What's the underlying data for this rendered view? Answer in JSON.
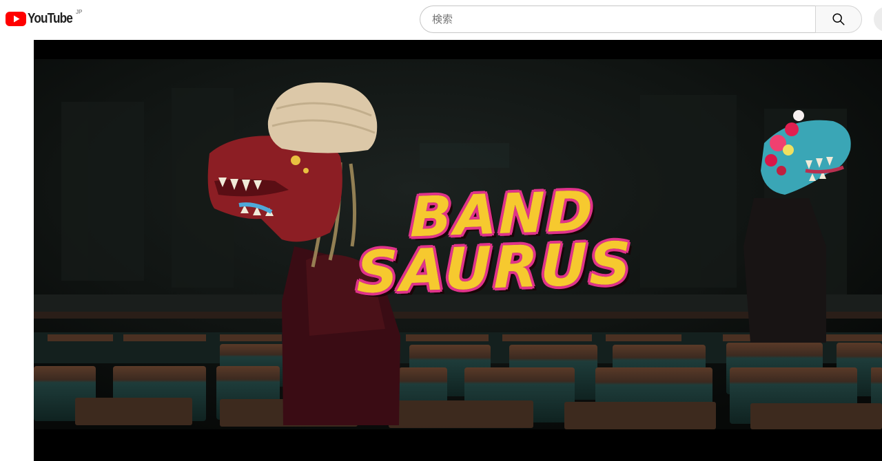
{
  "masthead": {
    "logo_text": "YouTube",
    "region_code": "JP",
    "brand_color": "#ff0000"
  },
  "search": {
    "placeholder": "検索",
    "value": "",
    "button_icon": "search-icon"
  },
  "video": {
    "title_card_line1": "BAND",
    "title_card_line2": "SAURUS",
    "title_fill_color": "#f6c92f",
    "title_outline_color": "#e0338a"
  }
}
